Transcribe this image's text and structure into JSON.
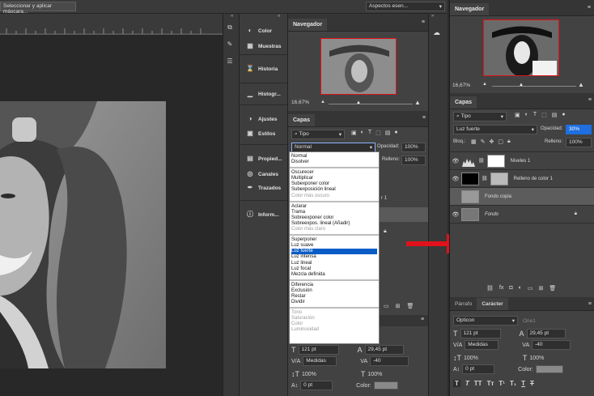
{
  "toolbar": {
    "select_mask": "Seleccionar y aplicar máscara...",
    "workspace": "Aspectos esen..."
  },
  "dock": [
    {
      "icon": "swatch-icon",
      "items": [
        {
          "icon": "color-icon",
          "label": "Color"
        },
        {
          "icon": "grid-icon",
          "label": "Muestras"
        }
      ]
    },
    {
      "icon": "history-icon",
      "items": [
        {
          "icon": "history-icon",
          "label": "Historia"
        }
      ]
    },
    {
      "icon": "histogram-icon",
      "items": [
        {
          "icon": "histogram-icon",
          "label": "Histogr..."
        }
      ]
    },
    {
      "icon": "adjust-icon",
      "items": [
        {
          "icon": "adjust-icon",
          "label": "Ajustes"
        },
        {
          "icon": "styles-icon",
          "label": "Estilos"
        }
      ]
    },
    {
      "icon": "props-icon",
      "items": [
        {
          "icon": "props-icon",
          "label": "Propied..."
        },
        {
          "icon": "channels-icon",
          "label": "Canales"
        },
        {
          "icon": "paths-icon",
          "label": "Trazados"
        }
      ]
    },
    {
      "icon": "info-icon",
      "items": [
        {
          "icon": "info-icon",
          "label": "Inform..."
        }
      ]
    }
  ],
  "left_nav": {
    "title": "Navegador",
    "zoom": "16,67%"
  },
  "left_layers": {
    "title": "Capas",
    "filter": "Tipo",
    "blend": "Normal",
    "opacity_label": "Opacidad:",
    "opacity": "100%",
    "fill_label": "Relleno:",
    "fill": "100%",
    "peek": "r 1"
  },
  "blend_menu": [
    [
      {
        "t": "Normal"
      },
      {
        "t": "Disolver"
      }
    ],
    [
      {
        "t": "Oscurecer"
      },
      {
        "t": "Multiplicar"
      },
      {
        "t": "Subexponer color"
      },
      {
        "t": "Subexposición lineal"
      },
      {
        "t": "Color más oscuro",
        "dis": true
      }
    ],
    [
      {
        "t": "Aclarar"
      },
      {
        "t": "Trama"
      },
      {
        "t": "Sobreexponer color"
      },
      {
        "t": "Sobreexpos. lineal (Añadir)"
      },
      {
        "t": "Color más claro",
        "dis": true
      }
    ],
    [
      {
        "t": "Superponer"
      },
      {
        "t": "Luz suave"
      },
      {
        "t": "Luz fuerte",
        "hl": true
      },
      {
        "t": "Luz intensa"
      },
      {
        "t": "Luz lineal"
      },
      {
        "t": "Luz focal"
      },
      {
        "t": "Mezcla definida"
      }
    ],
    [
      {
        "t": "Diferencia"
      },
      {
        "t": "Exclusión"
      },
      {
        "t": "Restar"
      },
      {
        "t": "Dividir"
      }
    ],
    [
      {
        "t": "Tono",
        "dis": true
      },
      {
        "t": "Saturación",
        "dis": true
      },
      {
        "t": "Color",
        "dis": true
      },
      {
        "t": "Luminosidad",
        "dis": true
      }
    ]
  ],
  "left_char": {
    "size": "121 pt",
    "leading": "29,45 pt",
    "kern": "Medidas",
    "track": "-40",
    "vscale": "100%",
    "hscale": "100%",
    "baseline": "0 pt",
    "color_label": "Color:"
  },
  "right_nav": {
    "title": "Navegador",
    "zoom": "16,67%"
  },
  "right_layers": {
    "title": "Capas",
    "filter": "Tipo",
    "blend": "Luz fuerte",
    "opacity_label": "Opacidad:",
    "opacity": "30%",
    "lock_label": "Bloq.:",
    "fill_label": "Relleno:",
    "fill": "100%",
    "layers": [
      {
        "name": "Niveles 1"
      },
      {
        "name": "Relleno de color 1"
      },
      {
        "name": "Fondo copia"
      },
      {
        "name": "Fondo"
      }
    ]
  },
  "right_char": {
    "tab1": "Párrafo",
    "tab2": "Carácter",
    "font": "Opticon",
    "style": "One1",
    "size": "121 pt",
    "leading": "29,45 pt",
    "kern": "Medidas",
    "track": "-40",
    "vscale": "100%",
    "hscale": "100%",
    "baseline": "0 pt",
    "color_label": "Color:"
  },
  "colors": {
    "arrow": "#e0121b",
    "highlight": "#0a5cc7"
  }
}
